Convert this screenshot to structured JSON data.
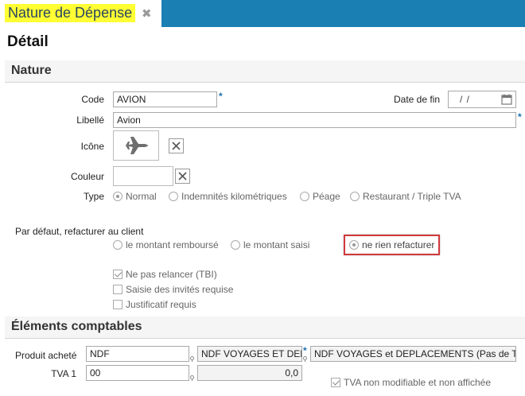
{
  "tab": {
    "title": "Nature de Dépense",
    "close": "✖"
  },
  "page_title": "Détail",
  "sections": {
    "nature": "Nature",
    "comptables": "Éléments comptables"
  },
  "fields": {
    "code_label": "Code",
    "code_value": "AVION",
    "date_fin_label": "Date de fin",
    "date_fin_value": " /  /",
    "libelle_label": "Libellé",
    "libelle_value": "Avion",
    "icone_label": "Icône",
    "couleur_label": "Couleur",
    "type_label": "Type",
    "required_mark": "*"
  },
  "type_options": [
    {
      "label": "Normal",
      "selected": true
    },
    {
      "label": "Indemnités kilométriques",
      "selected": false
    },
    {
      "label": "Péage",
      "selected": false
    },
    {
      "label": "Restaurant / Triple TVA",
      "selected": false
    }
  ],
  "refacturer": {
    "label": "Par défaut, refacturer au client",
    "options": [
      {
        "label": "le montant remboursé",
        "selected": false
      },
      {
        "label": "le montant saisi",
        "selected": false
      },
      {
        "label": "ne rien refacturer",
        "selected": true
      }
    ]
  },
  "checkboxes": [
    {
      "label": "Ne pas relancer (TBI)",
      "checked": true
    },
    {
      "label": "Saisie des invités requise",
      "checked": false
    },
    {
      "label": "Justificatif requis",
      "checked": false
    }
  ],
  "comptables": {
    "produit_label": "Produit acheté",
    "produit_code": "NDF",
    "produit_short": "NDF VOYAGES ET DEPLA",
    "produit_full": "NDF VOYAGES et DEPLACEMENTS (Pas de TVA)",
    "tva_label": "TVA 1",
    "tva_code": "00",
    "tva_rate": "0,0",
    "tva_check": "TVA non modifiable et non affichée"
  },
  "icons": {
    "icon": "airplane-icon",
    "clear": "close-icon",
    "calendar": "calendar-icon"
  },
  "colors": {
    "tab_bar": "#1a7fb3",
    "tab_highlight": "#ffff33",
    "required": "#1a6fb0",
    "highlight_border": "#d0393c"
  }
}
